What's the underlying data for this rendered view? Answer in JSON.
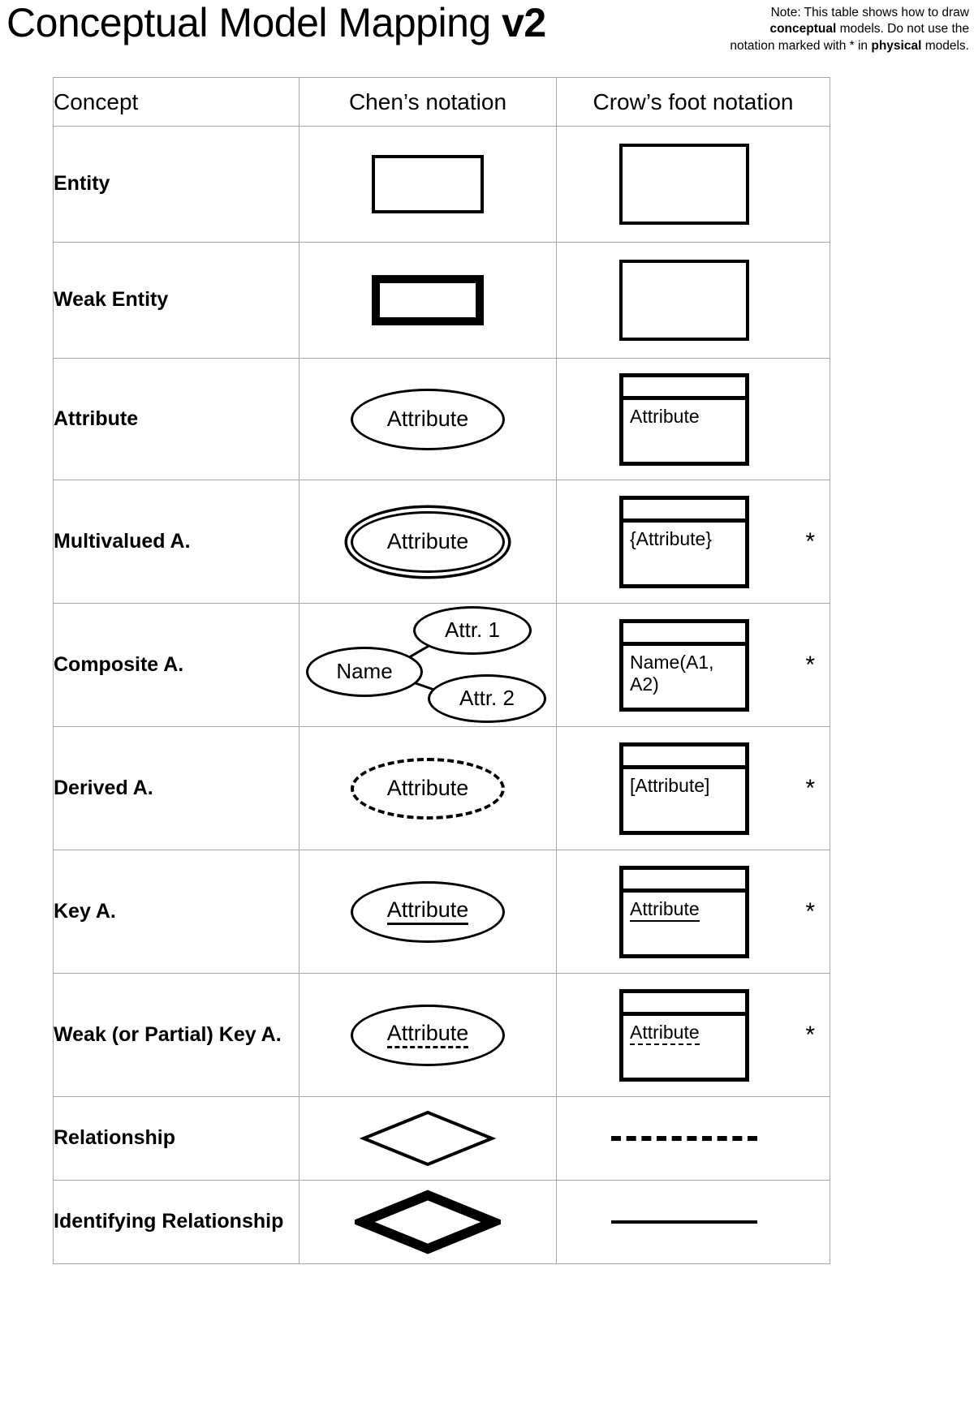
{
  "header": {
    "title_main": "Conceptual Model Mapping ",
    "title_version": "v2",
    "note_line1": "Note: This table shows how to draw ",
    "note_bold1": "conceptual",
    "note_line2": " models. Do not use the notation marked with * in ",
    "note_bold2": "physical",
    "note_line3": " models."
  },
  "table": {
    "columns": [
      "Concept",
      "Chen’s notation",
      "Crow’s foot notation"
    ],
    "rows": [
      {
        "concept": "Entity",
        "chen_kind": "rect-thin",
        "chen_text": "",
        "crow_kind": "box-plain-thin",
        "crow_text": "",
        "asterisk": ""
      },
      {
        "concept": "Weak Entity",
        "chen_kind": "rect-thick",
        "chen_text": "",
        "crow_kind": "box-plain-thin",
        "crow_text": "",
        "asterisk": ""
      },
      {
        "concept": "Attribute",
        "chen_kind": "ellipse",
        "chen_text": "Attribute",
        "crow_kind": "box-compartment",
        "crow_text": "Attribute",
        "asterisk": ""
      },
      {
        "concept": "Multivalued A.",
        "chen_kind": "ellipse-double",
        "chen_text": "Attribute",
        "crow_kind": "box-compartment",
        "crow_text": "{Attribute}",
        "asterisk": "*"
      },
      {
        "concept": "Composite A.",
        "chen_kind": "composite",
        "chen_text": "",
        "composite": {
          "name": "Name",
          "attr1": "Attr. 1",
          "attr2": "Attr. 2"
        },
        "crow_kind": "box-compartment",
        "crow_text": "Name(A1, A2)",
        "asterisk": "*"
      },
      {
        "concept": "Derived A.",
        "chen_kind": "ellipse-dashed",
        "chen_text": "Attribute",
        "crow_kind": "box-compartment",
        "crow_text": "[Attribute]",
        "asterisk": "*"
      },
      {
        "concept": "Key A.",
        "chen_kind": "ellipse-underline",
        "chen_text": "Attribute",
        "crow_kind": "box-compartment-underline",
        "crow_text": "Attribute",
        "asterisk": "*"
      },
      {
        "concept": "Weak (or Partial) Key A.",
        "chen_kind": "ellipse-underline-dashed",
        "chen_text": "Attribute",
        "crow_kind": "box-compartment-underline-dashed",
        "crow_text": "Attribute",
        "asterisk": "*"
      },
      {
        "concept": "Relationship",
        "chen_kind": "diamond-thin",
        "chen_text": "",
        "crow_kind": "line-dashed",
        "crow_text": "",
        "asterisk": ""
      },
      {
        "concept": "Identifying Relationship",
        "chen_kind": "diamond-thick",
        "chen_text": "",
        "crow_kind": "line-solid",
        "crow_text": "",
        "asterisk": ""
      }
    ]
  },
  "colors": {
    "ink": "#000000",
    "grid": "#a6a6a6",
    "background": "#ffffff"
  }
}
